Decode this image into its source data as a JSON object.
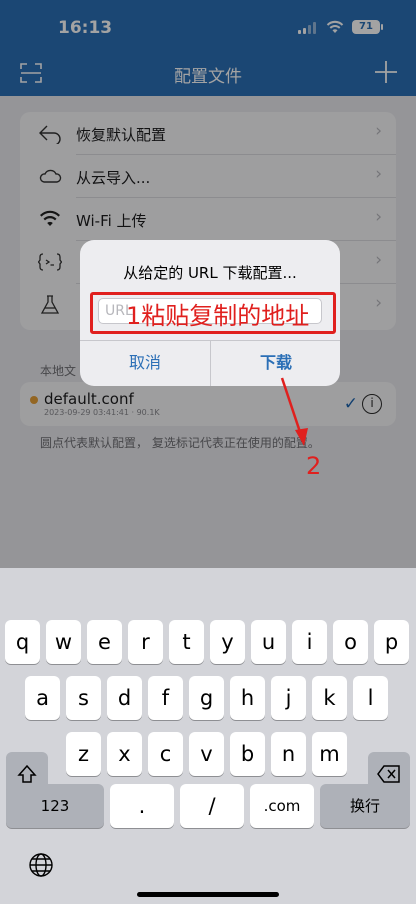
{
  "status": {
    "time": "16:13",
    "battery": "71"
  },
  "nav": {
    "title": "配置文件"
  },
  "menu": [
    {
      "icon": "undo-icon",
      "label": "恢复默认配置"
    },
    {
      "icon": "cloud-icon",
      "label": "从云导入..."
    },
    {
      "icon": "wifi-icon",
      "label": "Wi-Fi 上传"
    },
    {
      "icon": "code-icon",
      "label": ""
    },
    {
      "icon": "flask-icon",
      "label": ""
    }
  ],
  "chevron": "›",
  "local": {
    "section_title": "本地文",
    "file_name": "default.conf",
    "file_meta": "2023-09-29 03:41:41 · 90.1K",
    "footnote": "圆点代表默认配置， 复选标记代表正在使用的配置。"
  },
  "alert": {
    "title": "从给定的 URL 下载配置...",
    "input_placeholder": "URL",
    "cancel": "取消",
    "confirm": "下载"
  },
  "annotation": {
    "step1": "1粘贴复制的地址",
    "step2": "2",
    "color": "#e0201e"
  },
  "keyboard": {
    "row1": [
      "q",
      "w",
      "e",
      "r",
      "t",
      "y",
      "u",
      "i",
      "o",
      "p"
    ],
    "row2": [
      "a",
      "s",
      "d",
      "f",
      "g",
      "h",
      "j",
      "k",
      "l"
    ],
    "row3": [
      "z",
      "x",
      "c",
      "v",
      "b",
      "n",
      "m"
    ],
    "numbers": "123",
    "dot": ".",
    "slash": "/",
    "com": ".com",
    "return": "换行"
  },
  "colors": {
    "accent": "#2b6fb6",
    "dot_default": "#e6a038"
  }
}
